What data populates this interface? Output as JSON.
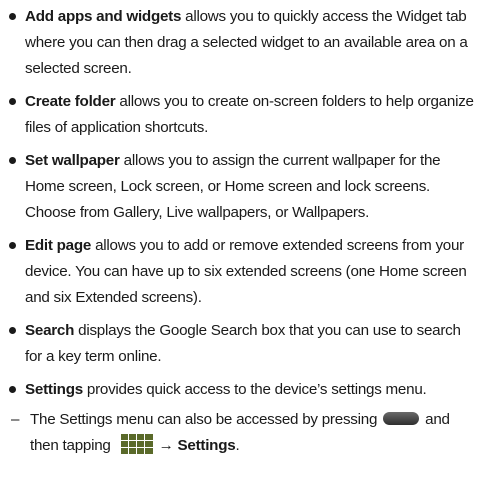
{
  "items": [
    {
      "term": "Add apps and widgets",
      "text": " allows you to quickly access the Widget tab where you can then drag a selected widget to an available area on a selected screen."
    },
    {
      "term": "Create folder",
      "text": " allows you to create on-screen folders to help organize files of application shortcuts."
    },
    {
      "term": "Set wallpaper",
      "text": " allows you to assign the current wallpaper for the Home screen, Lock screen, or Home screen and lock screens. Choose from Gallery, Live wallpapers, or Wallpapers."
    },
    {
      "term": "Edit page",
      "text": " allows you to add or remove extended screens from your device. You can have up to six extended screens (one Home screen and six Extended screens)."
    },
    {
      "term": "Search",
      "text": " displays the Google Search box that you can use to search for a key term online."
    },
    {
      "term": "Settings",
      "text": " provides quick access to the device’s settings menu."
    }
  ],
  "subitem": {
    "dash": "–",
    "text_before": "The Settings menu can also be accessed by pressing",
    "text_middle": "and then tapping",
    "arrow": "→",
    "target": "Settings",
    "end": "."
  },
  "icons": [
    "home-key-icon",
    "apps-grid-icon"
  ]
}
